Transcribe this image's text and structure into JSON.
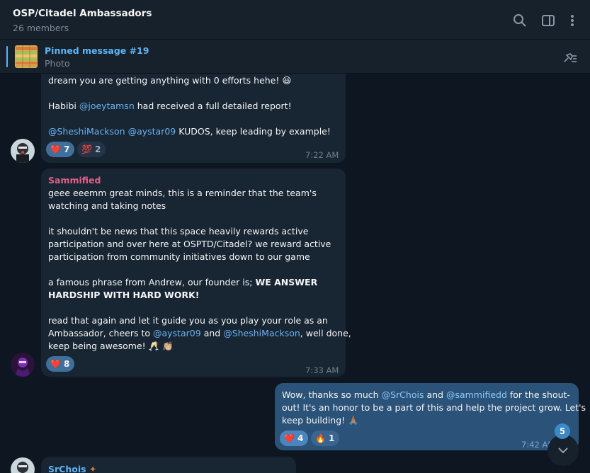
{
  "header": {
    "title": "OSP/Citadel Ambassadors",
    "subtitle": "26 members"
  },
  "pinned": {
    "title": "Pinned message #19",
    "subtitle": "Photo"
  },
  "messages": [
    {
      "lines": [
        "dream you are getting anything with 0 efforts hehe! 😆",
        "",
        "Habibi",
        "@joeytamsn",
        "had received a full detailed report!",
        "",
        "@SheshiMackson",
        "@aystar09",
        "KUDOS, keep leading by example!"
      ],
      "reactions": [
        {
          "emoji": "❤️",
          "count": "7"
        },
        {
          "emoji": "💯",
          "count": "2"
        }
      ],
      "time": "7:22 AM"
    },
    {
      "sender": "Sammified",
      "sender_color": "#e0608a",
      "l1": "geee eeemm great minds, this is a reminder that the team's",
      "l2": "watching and taking notes",
      "l3": "it shouldn't be news that this space heavily rewards active",
      "l4": "participation and over here at OSPTD/Citadel? we reward active",
      "l5": "participation from community initiatives down to our game",
      "l6a": "a famous phrase from Andrew, our founder is;",
      "l6b": "WE ANSWER",
      "l7": "HARDSHIP WITH HARD WORK!",
      "l8": "read that again and let it guide you as you play your role as an",
      "l9a": "Ambassador, cheers to",
      "l9b": "@aystar09",
      "l9c": "and",
      "l9d": "@SheshiMackson",
      "l9e": ", well done,",
      "l10": "keep being awesome! 🥂 👏🏼",
      "reactions": [
        {
          "emoji": "❤️",
          "count": "8"
        }
      ],
      "time": "7:33 AM"
    },
    {
      "l1a": "Wow, thanks so much",
      "l1b": "@SrChois",
      "l1c": "and",
      "l1d": "@sammifiedd",
      "l1e": "for the shout-",
      "l2": "out! It's an honor to be a part of this and help the project grow. Let's",
      "l3": "keep building! 🙏🏽",
      "reactions": [
        {
          "emoji": "❤️",
          "count": "4"
        },
        {
          "emoji": "🔥",
          "count": "1"
        }
      ],
      "time": "7:42 AM"
    },
    {
      "sender": "SrChois",
      "sender_color": "#5eb5f7"
    }
  ],
  "unread_count": "5"
}
